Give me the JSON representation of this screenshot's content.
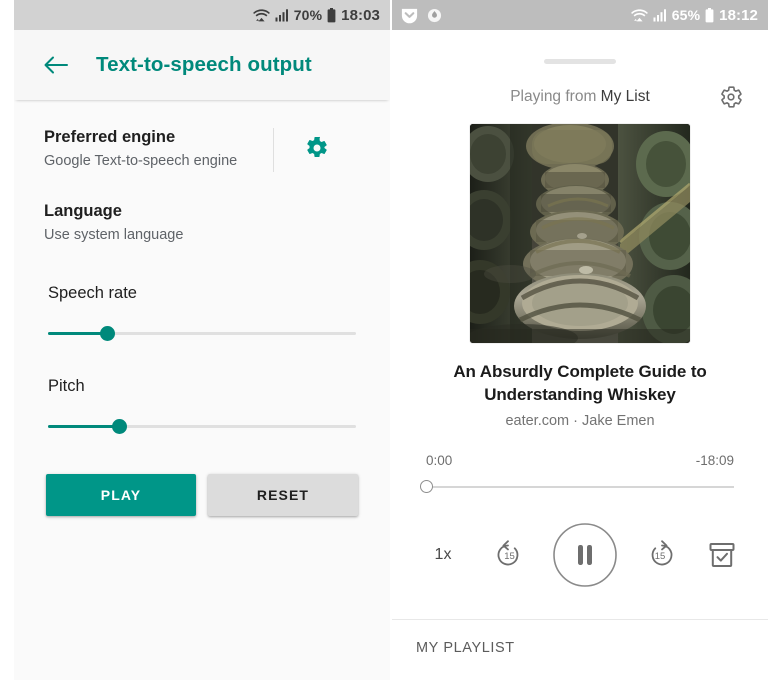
{
  "left_phone": {
    "statusbar": {
      "wifi_icon": "wifi-icon",
      "signal_icon": "signal-bars-icon",
      "battery_percent": "70%",
      "battery_icon": "battery-icon",
      "time": "18:03"
    },
    "appbar": {
      "back_icon": "back-arrow-icon",
      "title": "Text-to-speech output"
    },
    "settings": {
      "preferred_engine": {
        "title": "Preferred engine",
        "subtitle": "Google Text-to-speech engine",
        "gear_icon": "gear-icon"
      },
      "language": {
        "title": "Language",
        "subtitle": "Use system language"
      },
      "speech_rate": {
        "label": "Speech rate",
        "value_percent": 19
      },
      "pitch": {
        "label": "Pitch",
        "value_percent": 23
      }
    },
    "buttons": {
      "play": "PLAY",
      "reset": "RESET"
    },
    "colors": {
      "accent": "#009688",
      "appbar_title": "#00897b",
      "reset_bg": "#dcdcdc"
    }
  },
  "right_phone": {
    "statusbar": {
      "pocket_icon": "pocket-icon",
      "secondary_icon": "app-badge-icon",
      "wifi_icon": "wifi-icon",
      "signal_icon": "signal-bars-icon",
      "battery_percent": "65%",
      "battery_icon": "battery-icon",
      "time": "18:12"
    },
    "player": {
      "grabber": "drag-handle",
      "playing_from_prefix": "Playing from ",
      "playing_from_source": "My List",
      "settings_icon": "gear-icon",
      "artwork_alt": "whiskey-barrels-warehouse",
      "episode_title": "An Absurdly Complete Guide to Understanding Whiskey",
      "episode_meta": "eater.com · Jake Emen",
      "elapsed": "0:00",
      "remaining": "-18:09",
      "progress_percent": 0,
      "controls": {
        "speed": "1x",
        "rewind_icon": "rewind-15-icon",
        "rewind_label": "15",
        "play_pause_icon": "pause-icon",
        "forward_icon": "forward-15-icon",
        "forward_label": "15",
        "archive_icon": "archive-check-icon"
      }
    },
    "playlist": {
      "header": "MY PLAYLIST"
    },
    "colors": {
      "accent": "#17a39a",
      "statusbar_bg": "#bdbdbd"
    }
  }
}
